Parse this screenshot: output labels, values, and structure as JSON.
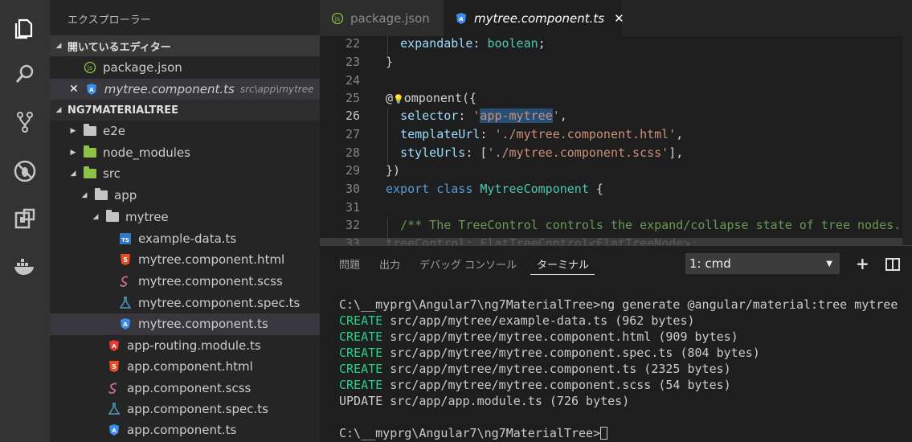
{
  "sidebar": {
    "title": "エクスプローラー",
    "open_editors_header": "開いているエディター",
    "open_editors": [
      {
        "name": "package.json",
        "path": ""
      },
      {
        "name": "mytree.component.ts",
        "path": "src\\app\\mytree"
      }
    ],
    "project_header": "NG7MATERIALTREE",
    "tree": {
      "e2e": "e2e",
      "node_modules": "node_modules",
      "src": "src",
      "app": "app",
      "mytree": "mytree",
      "mytree_files": [
        "example-data.ts",
        "mytree.component.html",
        "mytree.component.scss",
        "mytree.component.spec.ts",
        "mytree.component.ts"
      ],
      "app_files": [
        "app-routing.module.ts",
        "app.component.html",
        "app.component.scss",
        "app.component.spec.ts",
        "app.component.ts"
      ]
    }
  },
  "tabs": [
    {
      "label": "package.json",
      "icon": "npm-icon"
    },
    {
      "label": "mytree.component.ts",
      "icon": "angular-icon",
      "close": "✕"
    }
  ],
  "editor": {
    "line_numbers": [
      "22",
      "23",
      "24",
      "25",
      "26",
      "27",
      "28",
      "29",
      "30",
      "31",
      "32",
      "33"
    ],
    "current_line": "26",
    "lines": {
      "l22_prop": "expandable",
      "l22_type": "boolean",
      "l23": "}",
      "l25_at": "@",
      "l25_name": "omponent({",
      "l26_key": "selector",
      "l26_val": "app-mytree",
      "l27_key": "templateUrl",
      "l27_val": "'./mytree.component.html'",
      "l28_key": "styleUrls",
      "l28_val": "'./mytree.component.scss'",
      "l29": "})",
      "l30_export": "export",
      "l30_class": "class",
      "l30_name": "MytreeComponent",
      "l30_brace": "{",
      "l32_comment": "/** The TreeControl controls the expand/collapse state of tree nodes.",
      "l33": "treeControl: FlatTreeControl<FlatTreeNode>;"
    }
  },
  "panel": {
    "tabs": [
      "問題",
      "出力",
      "デバッグ コンソール",
      "ターミナル"
    ],
    "active_tab": "ターミナル",
    "terminal_select": "1: cmd",
    "terminal_lines": [
      {
        "prefix": "",
        "text": "C:\\__myprg\\Angular7\\ng7MaterialTree>ng generate @angular/material:tree mytree"
      },
      {
        "prefix": "CREATE",
        "text": " src/app/mytree/example-data.ts (962 bytes)"
      },
      {
        "prefix": "CREATE",
        "text": " src/app/mytree/mytree.component.html (909 bytes)"
      },
      {
        "prefix": "CREATE",
        "text": " src/app/mytree/mytree.component.spec.ts (804 bytes)"
      },
      {
        "prefix": "CREATE",
        "text": " src/app/mytree/mytree.component.ts (2325 bytes)"
      },
      {
        "prefix": "CREATE",
        "text": " src/app/mytree/mytree.component.scss (54 bytes)"
      },
      {
        "prefix": "",
        "text": "UPDATE src/app/app.module.ts (726 bytes)"
      }
    ],
    "prompt": "C:\\__myprg\\Angular7\\ng7MaterialTree>"
  },
  "colors": {
    "activity_bar": "#333333",
    "sidebar": "#252526",
    "editor_bg": "#1e1e1e",
    "keyword": "#569cd6",
    "string": "#ce9178",
    "terminal_green": "#23d18b"
  }
}
